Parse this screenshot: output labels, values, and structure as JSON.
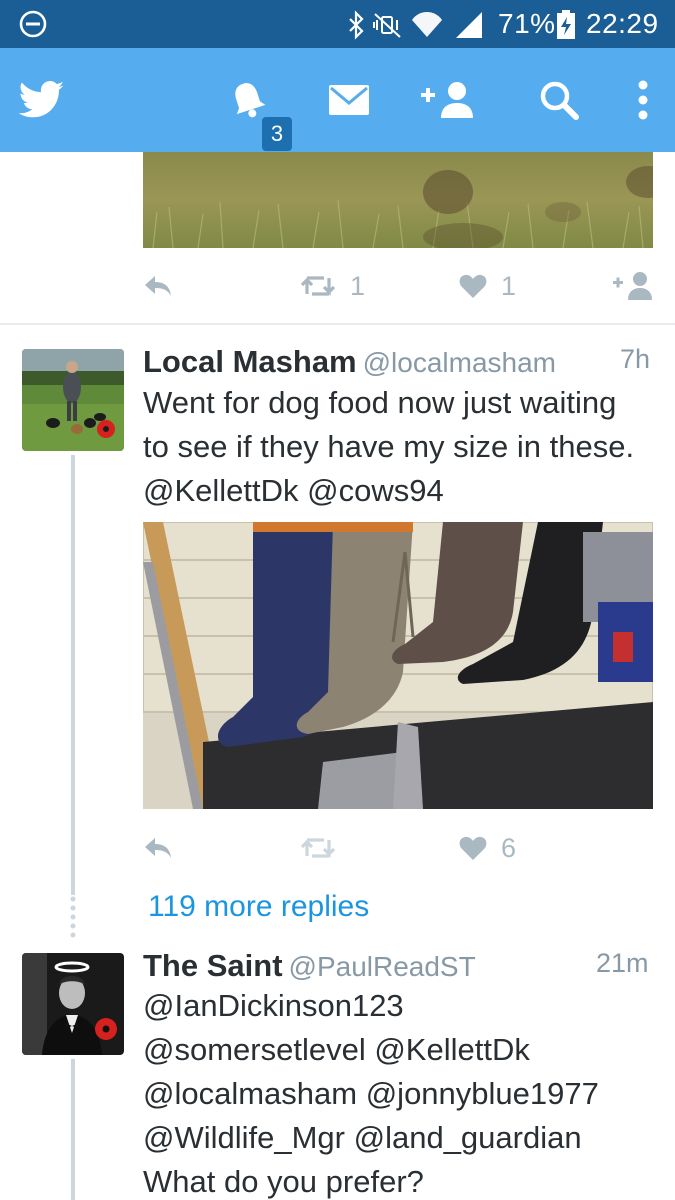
{
  "status_bar": {
    "battery_percent": "71%",
    "time": "22:29",
    "icons": [
      "do-not-disturb-icon",
      "bluetooth-icon",
      "vibrate-icon",
      "wifi-icon",
      "signal-icon",
      "battery-charging-icon"
    ]
  },
  "app_bar": {
    "icons": [
      "twitter-bird-icon",
      "notifications-bell-icon",
      "messages-envelope-icon",
      "add-user-icon",
      "search-icon",
      "more-vert-icon"
    ],
    "notification_count": "3",
    "color": "#55acee"
  },
  "previous_tweet": {
    "retweet_count": "1",
    "like_count": "1"
  },
  "tweets": [
    {
      "name": "Local Masham",
      "handle": "@localmasham",
      "time": "7h",
      "text": "Went for dog food now just waiting\nto see if they have my size in these.\n@KellettDk @cows94",
      "retweet_count": "",
      "like_count": "6"
    },
    {
      "name": "The Saint",
      "handle": "@PaulReadST",
      "time": "21m",
      "text": "@IanDickinson123\n@somersetlevel @KellettDk\n@localmasham @jonnyblue1977\n@Wildlife_Mgr @land_guardian\nWhat do you prefer?"
    }
  ],
  "more_replies": "119 more replies"
}
